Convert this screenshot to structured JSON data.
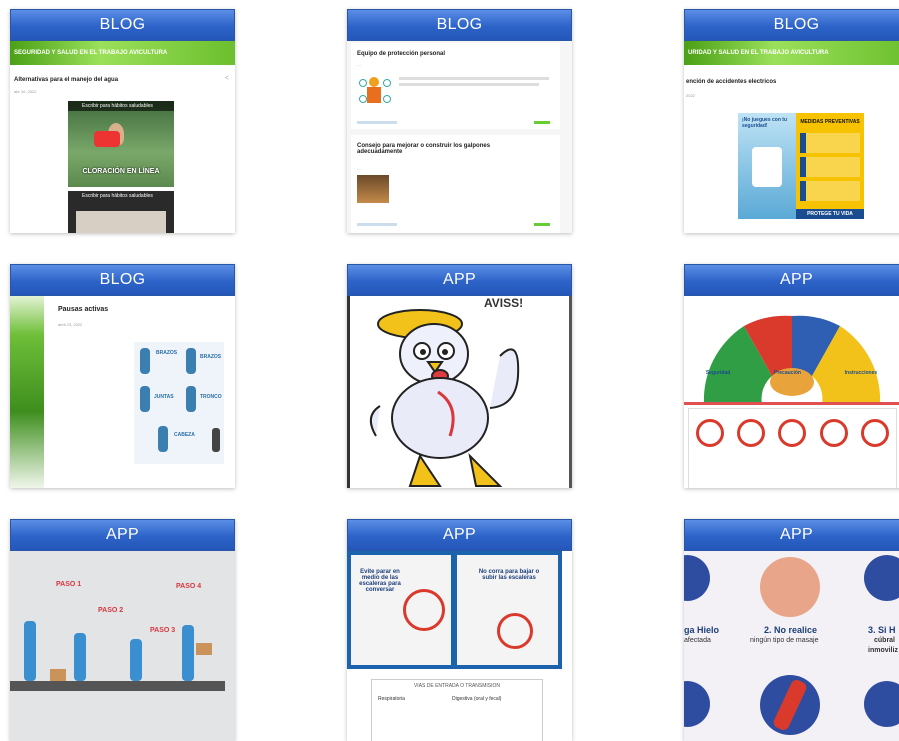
{
  "cards": [
    {
      "tag": "BLOG",
      "banner": "SEGURIDAD Y SALUD EN EL TRABAJO AVICULTURA",
      "post_title": "Alternativas para el manejo del agua",
      "date": "abr 10, 2022",
      "video_title": "Escribir para hábitos saludables",
      "video_caption": "CLORACIÓN EN LÍNEA"
    },
    {
      "tag": "BLOG",
      "post1_title": "Equipo de protección personal",
      "post2_title": "Consejo para mejorar o construir los galpones adecuadamente"
    },
    {
      "tag": "BLOG",
      "banner": "URIDAD Y SALUD EN EL TRABAJO AVICULTURA",
      "post_title": "ención de accidentes electricos",
      "date": "2022",
      "poster_question": "¡No juegues con tu seguridad!",
      "poster_heading": "MEDIDAS PREVENTIVAS",
      "poster_footer": "PROTEGE TU VIDA"
    },
    {
      "tag": "BLOG",
      "post_title": "Pausas activas",
      "date": "abril 23, 2022",
      "labels": [
        "BRAZOS",
        "BRAZOS",
        "JUNTAS",
        "TRONCO",
        "CABEZA"
      ]
    },
    {
      "tag": "APP",
      "caption": "AVISS!"
    },
    {
      "tag": "APP",
      "labels": [
        "Seguridad",
        "Precaución",
        "Instrucciones"
      ]
    },
    {
      "tag": "APP",
      "steps": [
        "PASO 1",
        "PASO 2",
        "PASO 3",
        "PASO 4"
      ]
    },
    {
      "tag": "APP",
      "left_text": "Evite parar en medio de las escaleras para conversar",
      "right_text": "No corra para bajar o subir las escaleras",
      "lower_title": "VIAS DE ENTRADA O TRANSMISION",
      "lower_labels": [
        "Respiratoria",
        "Digestiva (oral y fecal)"
      ]
    },
    {
      "tag": "APP",
      "left_text": "ga Hielo",
      "left_sub": "afectada",
      "mid_text": "2. No realice",
      "mid_sub": "ningún tipo de masaje",
      "right_text": "3. Si H",
      "right_sub1": "cúbral",
      "right_sub2": "inmoviliz"
    }
  ]
}
